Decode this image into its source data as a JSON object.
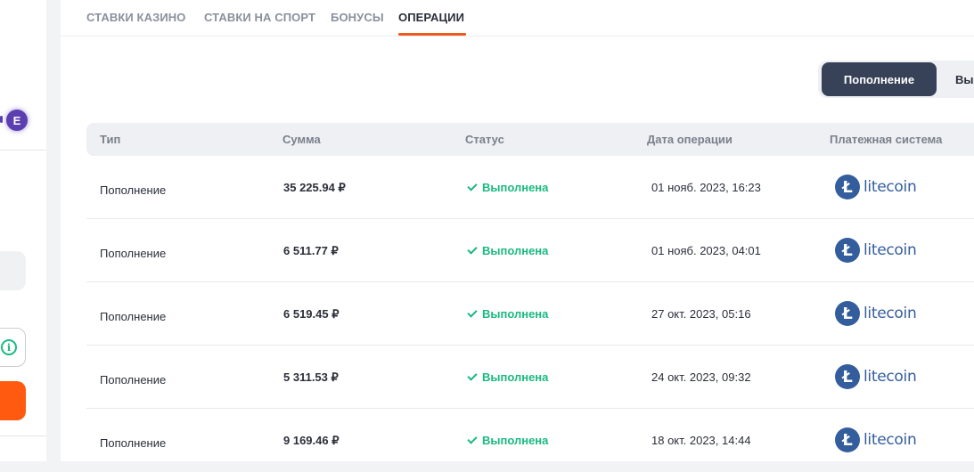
{
  "left_panel": {
    "avatar_letter": "E"
  },
  "tabs": [
    {
      "label": "СТАВКИ КАЗИНО",
      "active": false
    },
    {
      "label": "СТАВКИ НА СПОРТ",
      "active": false
    },
    {
      "label": "БОНУСЫ",
      "active": false
    },
    {
      "label": "ОПЕРАЦИИ",
      "active": true
    }
  ],
  "toggle": {
    "active_label": "Пополнение",
    "inactive_label": "Вы"
  },
  "table": {
    "headers": [
      "Тип",
      "Сумма",
      "Статус",
      "Дата операции",
      "Платежная система"
    ],
    "rows": [
      {
        "type": "Пополнение",
        "amount": "35 225.94 ₽",
        "status": "Выполнена",
        "date": "01 нояб. 2023, 16:23",
        "system": "litecoin"
      },
      {
        "type": "Пополнение",
        "amount": "6 511.77 ₽",
        "status": "Выполнена",
        "date": "01 нояб. 2023, 04:01",
        "system": "litecoin"
      },
      {
        "type": "Пополнение",
        "amount": "6 519.45 ₽",
        "status": "Выполнена",
        "date": "27 окт. 2023, 05:16",
        "system": "litecoin"
      },
      {
        "type": "Пополнение",
        "amount": "5 311.53 ₽",
        "status": "Выполнена",
        "date": "24 окт. 2023, 09:32",
        "system": "litecoin"
      },
      {
        "type": "Пополнение",
        "amount": "9 169.46 ₽",
        "status": "Выполнена",
        "date": "18 окт. 2023, 14:44",
        "system": "litecoin"
      }
    ]
  },
  "colors": {
    "accent": "#ee5a1d",
    "success": "#1ab980",
    "toggle_active": "#374157",
    "litecoin": "#345d9d"
  },
  "icons": {
    "status": "check-icon",
    "payment": "litecoin-icon",
    "info": "info-icon"
  }
}
